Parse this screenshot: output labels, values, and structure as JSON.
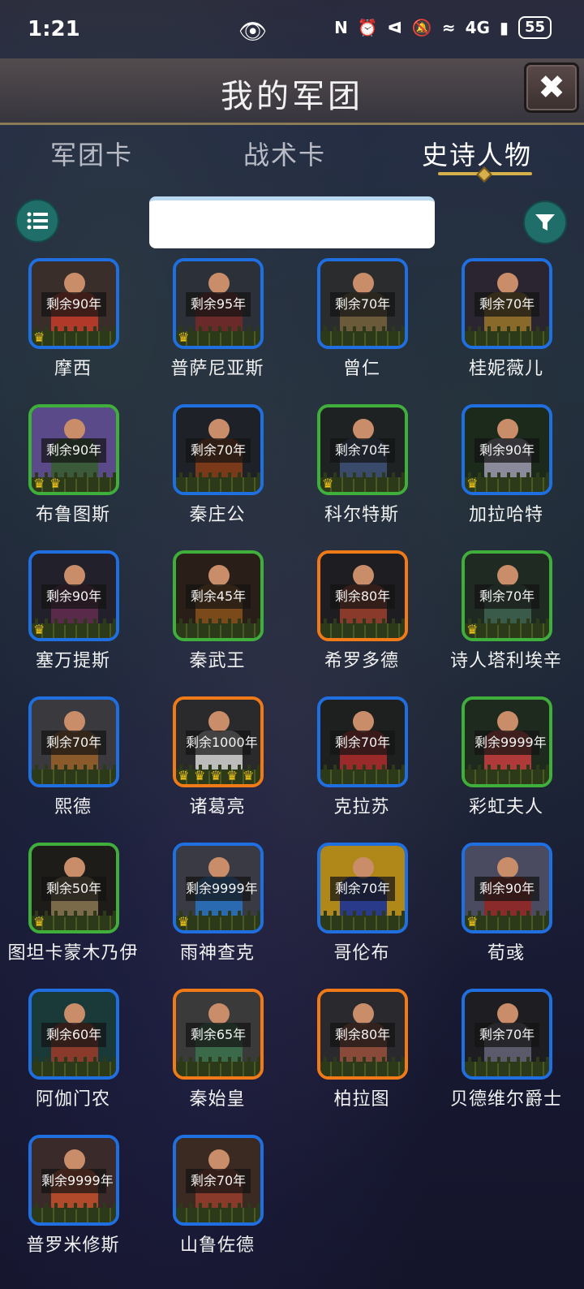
{
  "status_bar": {
    "time": "1:21",
    "signal": "4G",
    "battery": "55"
  },
  "header": {
    "title": "我的军团",
    "close_icon": "close-x-icon"
  },
  "tabs": [
    {
      "label": "军团卡",
      "active": false
    },
    {
      "label": "战术卡",
      "active": false
    },
    {
      "label": "史诗人物",
      "active": true
    }
  ],
  "controls": {
    "list_icon": "list-icon",
    "filter_icon": "filter-icon",
    "search_value": ""
  },
  "colors": {
    "blue": "#1f6fe0",
    "green": "#3fae3b",
    "orange": "#ef7a17",
    "accent": "#d6b04a",
    "round_button": "#1f6e6a"
  },
  "cards": [
    {
      "name": "摩西",
      "remaining": "剩余90年",
      "rarity": "blue",
      "crowns": 1,
      "art": [
        "#3a2e2a",
        "#b0392a"
      ]
    },
    {
      "name": "普萨尼亚斯",
      "remaining": "剩余95年",
      "rarity": "blue",
      "crowns": 1,
      "art": [
        "#2c3038",
        "#6a2a2a"
      ]
    },
    {
      "name": "曾仁",
      "remaining": "剩余70年",
      "rarity": "blue",
      "crowns": 0,
      "art": [
        "#2a2c2e",
        "#6a5a3a"
      ]
    },
    {
      "name": "桂妮薇儿",
      "remaining": "剩余70年",
      "rarity": "blue",
      "crowns": 0,
      "art": [
        "#2a2530",
        "#8a6a2a"
      ]
    },
    {
      "name": "布鲁图斯",
      "remaining": "剩余90年",
      "rarity": "green",
      "crowns": 2,
      "art": [
        "#5a4a8a",
        "#3a5a3a"
      ]
    },
    {
      "name": "秦庄公",
      "remaining": "剩余70年",
      "rarity": "blue",
      "crowns": 0,
      "art": [
        "#1e2228",
        "#7a3a1a"
      ]
    },
    {
      "name": "科尔特斯",
      "remaining": "剩余70年",
      "rarity": "green",
      "crowns": 1,
      "art": [
        "#1e2222",
        "#3a4a6a"
      ]
    },
    {
      "name": "加拉哈特",
      "remaining": "剩余90年",
      "rarity": "blue",
      "crowns": 1,
      "art": [
        "#1c2a1c",
        "#8a8a9a"
      ]
    },
    {
      "name": "塞万提斯",
      "remaining": "剩余90年",
      "rarity": "blue",
      "crowns": 1,
      "art": [
        "#22202a",
        "#5a2a4a"
      ]
    },
    {
      "name": "秦武王",
      "remaining": "剩余45年",
      "rarity": "green",
      "crowns": 0,
      "art": [
        "#2a1e18",
        "#7a4a1a"
      ]
    },
    {
      "name": "希罗多德",
      "remaining": "剩余80年",
      "rarity": "orange",
      "crowns": 0,
      "art": [
        "#1e1e22",
        "#8a3a2a"
      ]
    },
    {
      "name": "诗人塔利埃辛",
      "remaining": "剩余70年",
      "rarity": "green",
      "crowns": 1,
      "art": [
        "#1e2a22",
        "#3a5a4a"
      ]
    },
    {
      "name": "熙德",
      "remaining": "剩余70年",
      "rarity": "blue",
      "crowns": 0,
      "art": [
        "#3a3a3e",
        "#8a5a2a"
      ]
    },
    {
      "name": "诸葛亮",
      "remaining": "剩余1000年",
      "rarity": "orange",
      "crowns": 5,
      "art": [
        "#2a2a2c",
        "#bcbcbc"
      ]
    },
    {
      "name": "克拉苏",
      "remaining": "剩余70年",
      "rarity": "blue",
      "crowns": 0,
      "art": [
        "#1e2020",
        "#9a2a2a"
      ]
    },
    {
      "name": "彩虹夫人",
      "remaining": "剩余9999年",
      "rarity": "green",
      "crowns": 0,
      "art": [
        "#1e2a1e",
        "#b03a3a"
      ]
    },
    {
      "name": "图坦卡蒙木乃伊",
      "remaining": "剩余50年",
      "rarity": "green",
      "crowns": 1,
      "art": [
        "#1e1c18",
        "#7a6a4a"
      ]
    },
    {
      "name": "雨神查克",
      "remaining": "剩余9999年",
      "rarity": "blue",
      "crowns": 1,
      "art": [
        "#3a3a44",
        "#2a6ab0"
      ]
    },
    {
      "name": "哥伦布",
      "remaining": "剩余70年",
      "rarity": "blue",
      "crowns": 0,
      "art": [
        "#b0881a",
        "#2a3a8a"
      ]
    },
    {
      "name": "荀彧",
      "remaining": "剩余90年",
      "rarity": "blue",
      "crowns": 1,
      "art": [
        "#4a4a60",
        "#8a2a2a"
      ]
    },
    {
      "name": "阿伽门农",
      "remaining": "剩余60年",
      "rarity": "blue",
      "crowns": 0,
      "art": [
        "#1a3a3a",
        "#8a3a2a"
      ]
    },
    {
      "name": "秦始皇",
      "remaining": "剩余65年",
      "rarity": "orange",
      "crowns": 0,
      "art": [
        "#3a3a3a",
        "#3a6a4a"
      ]
    },
    {
      "name": "柏拉图",
      "remaining": "剩余80年",
      "rarity": "orange",
      "crowns": 0,
      "art": [
        "#2a2a2e",
        "#8a4a3a"
      ]
    },
    {
      "name": "贝德维尔爵士",
      "remaining": "剩余70年",
      "rarity": "blue",
      "crowns": 0,
      "art": [
        "#1e1e22",
        "#5a5a6a"
      ]
    },
    {
      "name": "普罗米修斯",
      "remaining": "剩余9999年",
      "rarity": "blue",
      "crowns": 0,
      "art": [
        "#3a2a2a",
        "#b04a2a"
      ]
    },
    {
      "name": "山鲁佐德",
      "remaining": "剩余70年",
      "rarity": "blue",
      "crowns": 0,
      "art": [
        "#3a2a22",
        "#8a3a2a"
      ]
    }
  ]
}
